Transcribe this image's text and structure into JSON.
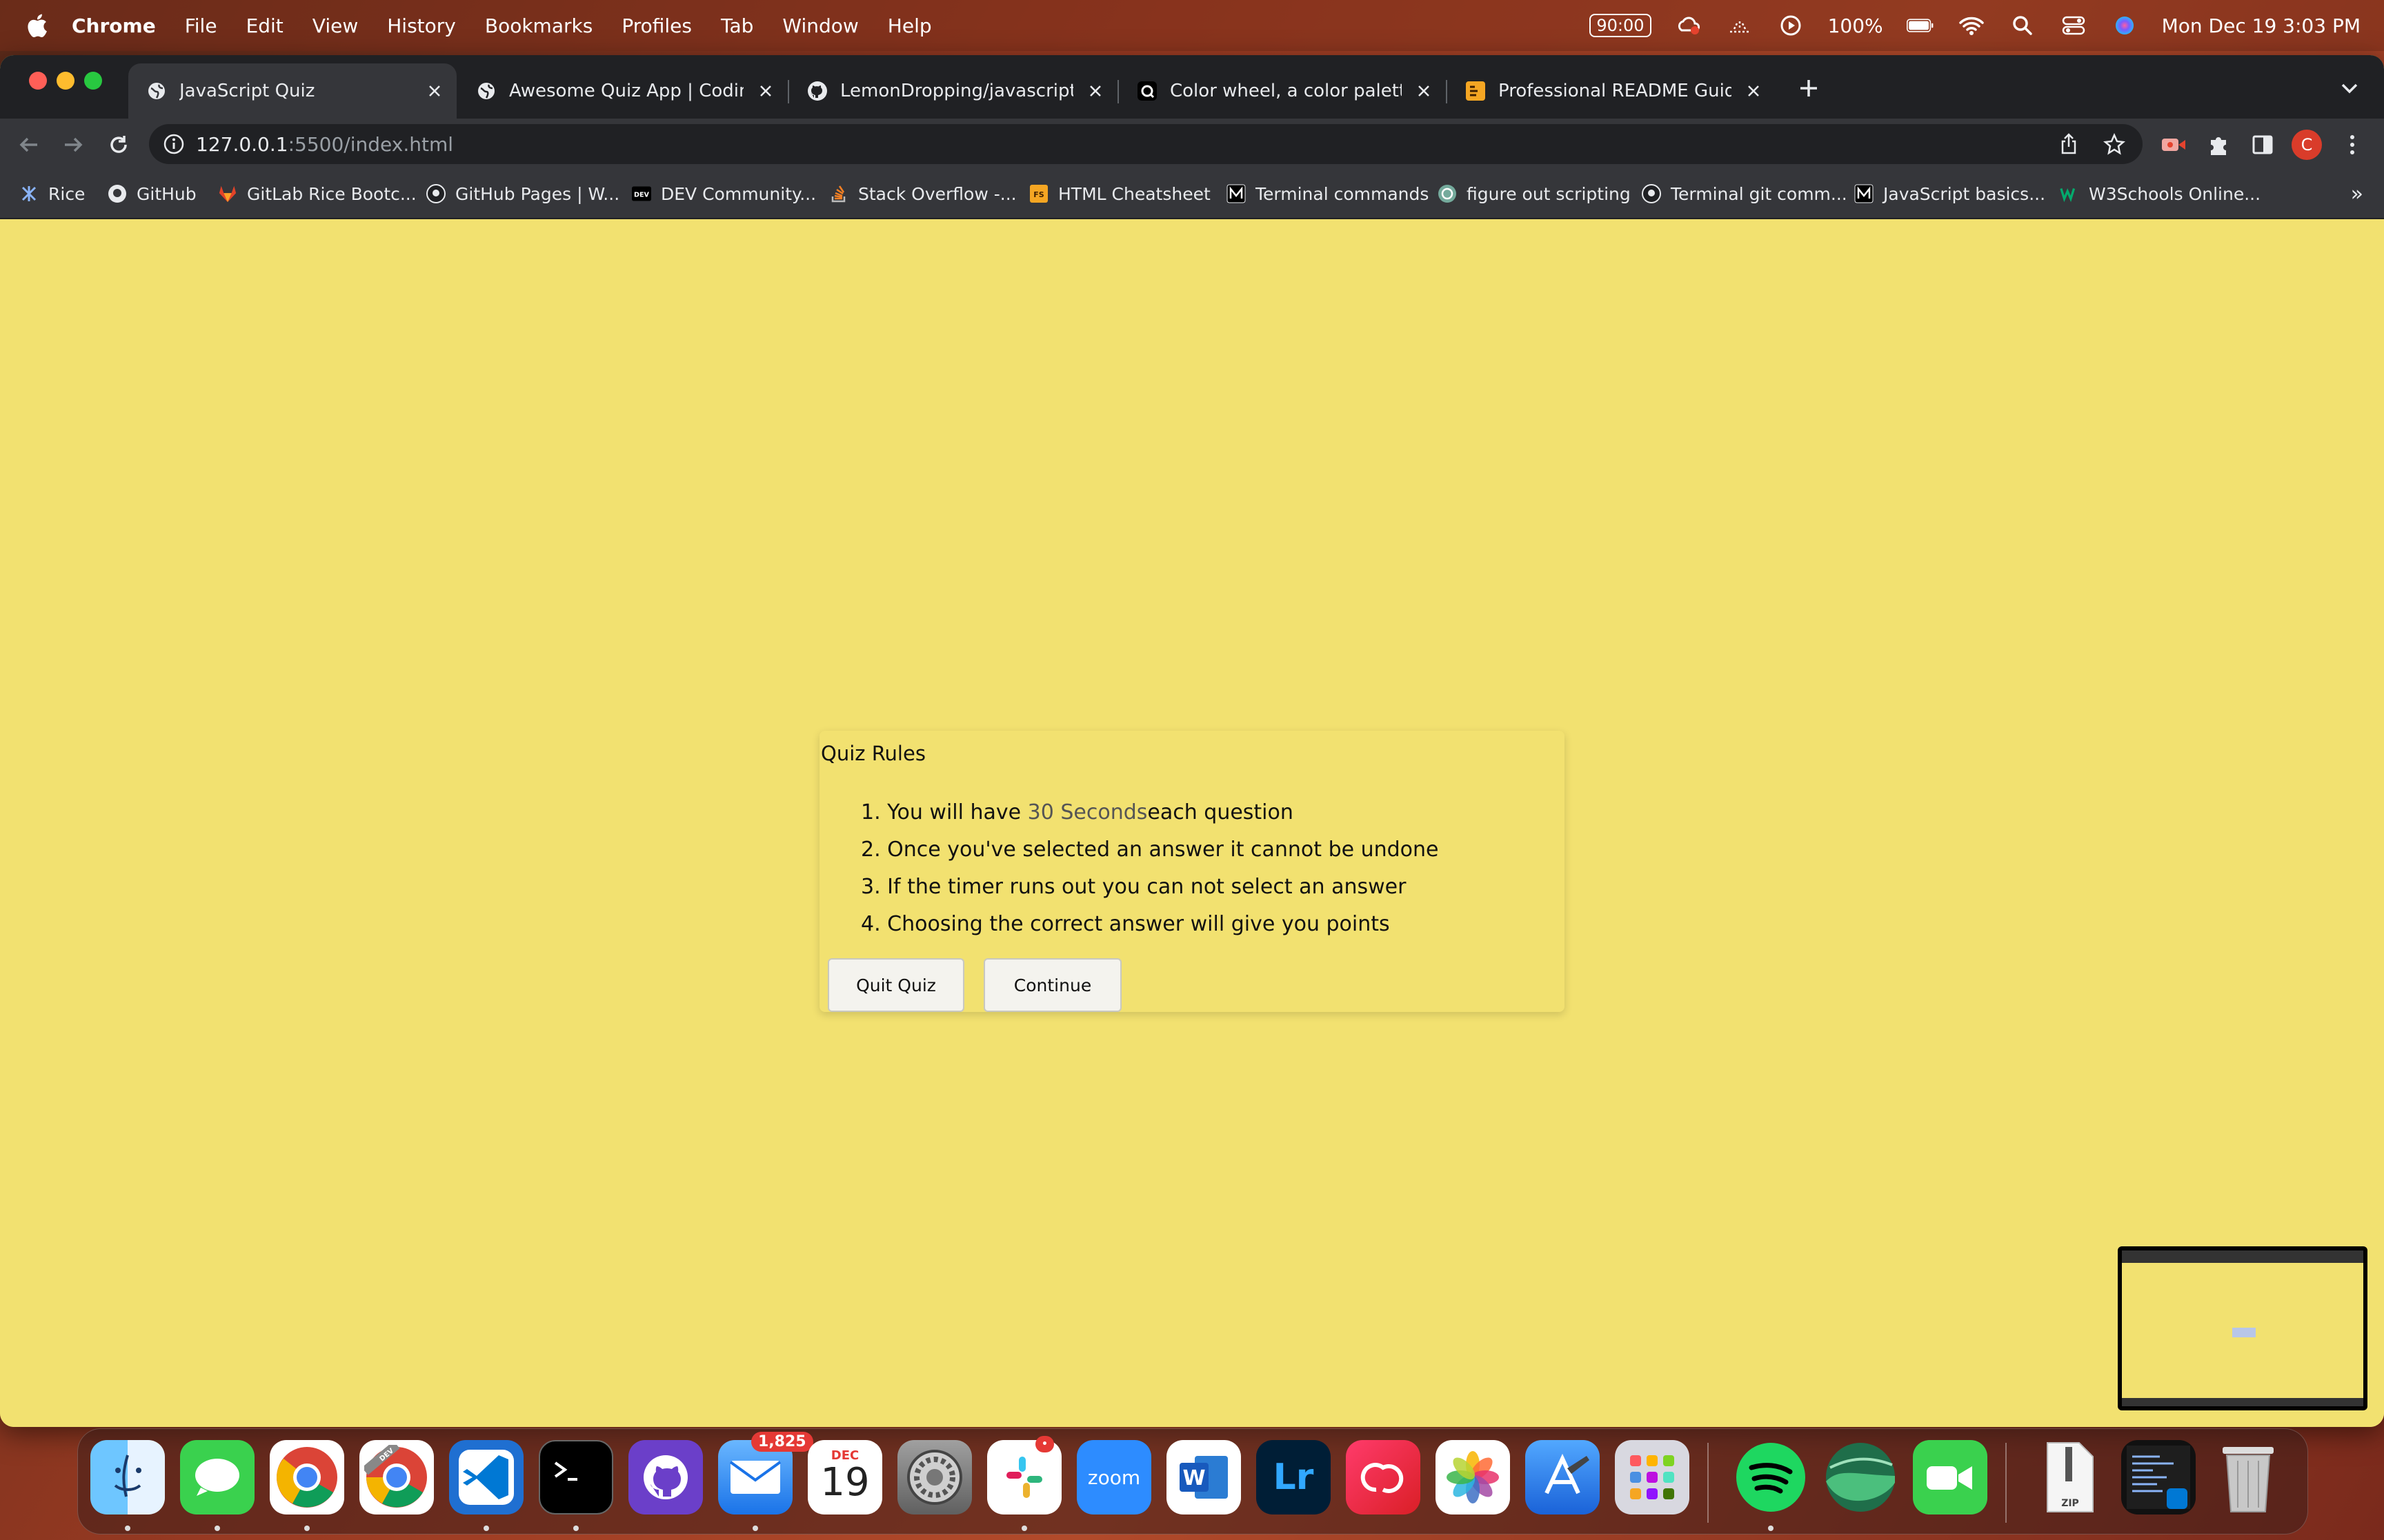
{
  "menubar": {
    "app": "Chrome",
    "items": [
      "File",
      "Edit",
      "View",
      "History",
      "Bookmarks",
      "Profiles",
      "Tab",
      "Window",
      "Help"
    ],
    "timer": "90:00",
    "battery": "100%",
    "datetime": "Mon Dec 19  3:03 PM"
  },
  "tabs": [
    {
      "title": "JavaScript Quiz",
      "icon": "globe-icon",
      "active": true
    },
    {
      "title": "Awesome Quiz App | CodingNe",
      "icon": "globe-icon",
      "active": false
    },
    {
      "title": "LemonDropping/javascript-qui",
      "icon": "github-icon",
      "active": false
    },
    {
      "title": "Color wheel, a color palette ge",
      "icon": "colorwheel-icon",
      "active": false
    },
    {
      "title": "Professional README Guide | T",
      "icon": "readme-icon",
      "active": false
    }
  ],
  "address": {
    "host": "127.0.0.1",
    "rest": ":5500/index.html"
  },
  "profile_initial": "C",
  "bookmarks": [
    {
      "label": "Rice",
      "icon": "rice-icon"
    },
    {
      "label": "GitHub",
      "icon": "github-icon"
    },
    {
      "label": "GitLab Rice Bootc...",
      "icon": "gitlab-icon"
    },
    {
      "label": "GitHub Pages | W...",
      "icon": "github-icon"
    },
    {
      "label": "DEV Community...",
      "icon": "dev-icon"
    },
    {
      "label": "Stack Overflow -...",
      "icon": "stackoverflow-icon"
    },
    {
      "label": "HTML Cheatsheet",
      "icon": "cheatsheet-icon"
    },
    {
      "label": "Terminal commands",
      "icon": "medium-icon"
    },
    {
      "label": "figure out scripting",
      "icon": "openai-icon"
    },
    {
      "label": "Terminal git comm...",
      "icon": "github-icon"
    },
    {
      "label": "JavaScript basics...",
      "icon": "medium-icon"
    },
    {
      "label": "W3Schools Online...",
      "icon": "w3schools-icon"
    }
  ],
  "quiz": {
    "title": "Quiz Rules",
    "rules": [
      {
        "prefix": "1. You will have ",
        "highlight": "30 Seconds",
        "suffix": "each question"
      },
      {
        "prefix": "2. Once you've selected an answer it cannot be undone",
        "highlight": "",
        "suffix": ""
      },
      {
        "prefix": "3. If the timer runs out you can not select an answer",
        "highlight": "",
        "suffix": ""
      },
      {
        "prefix": "4. Choosing the correct answer will give you points",
        "highlight": "",
        "suffix": ""
      }
    ],
    "quit_label": "Quit Quiz",
    "continue_label": "Continue"
  },
  "dock": {
    "mail_badge": "1,825",
    "calendar_month": "DEC",
    "calendar_day": "19",
    "zoom_label": "zoom",
    "lr_label": "Lr",
    "word_label": "W",
    "zip_label": "ZIP",
    "dev_label": "DEV"
  },
  "colors": {
    "page_bg": "#f2e170",
    "tabstrip": "#202124",
    "toolbar": "#35363a",
    "profile": "#d93c2a"
  }
}
